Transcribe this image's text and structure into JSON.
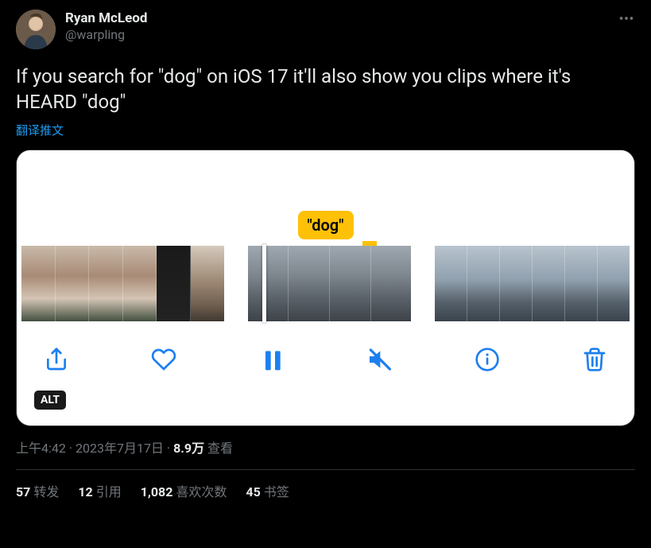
{
  "user": {
    "display_name": "Ryan McLeod",
    "handle": "@warpling"
  },
  "tweet": {
    "text": "If you search for \"dog\" on iOS 17 it'll also show you clips where it's HEARD \"dog\"",
    "translate_label": "翻译推文"
  },
  "media": {
    "dog_label": "\"dog\"",
    "alt_label": "ALT",
    "icons": {
      "share": "share-icon",
      "like": "heart-icon",
      "pause": "pause-icon",
      "mute": "mute-icon",
      "info": "info-icon",
      "delete": "trash-icon"
    }
  },
  "meta": {
    "time": "上午4:42",
    "dot1": " · ",
    "date": "2023年7月17日",
    "dot2": " · ",
    "views_number": "8.9万",
    "views_label": " 查看"
  },
  "stats": {
    "retweets_num": "57",
    "retweets_label": "转发",
    "quotes_num": "12",
    "quotes_label": "引用",
    "likes_num": "1,082",
    "likes_label": "喜欢次数",
    "bookmarks_num": "45",
    "bookmarks_label": "书签"
  }
}
